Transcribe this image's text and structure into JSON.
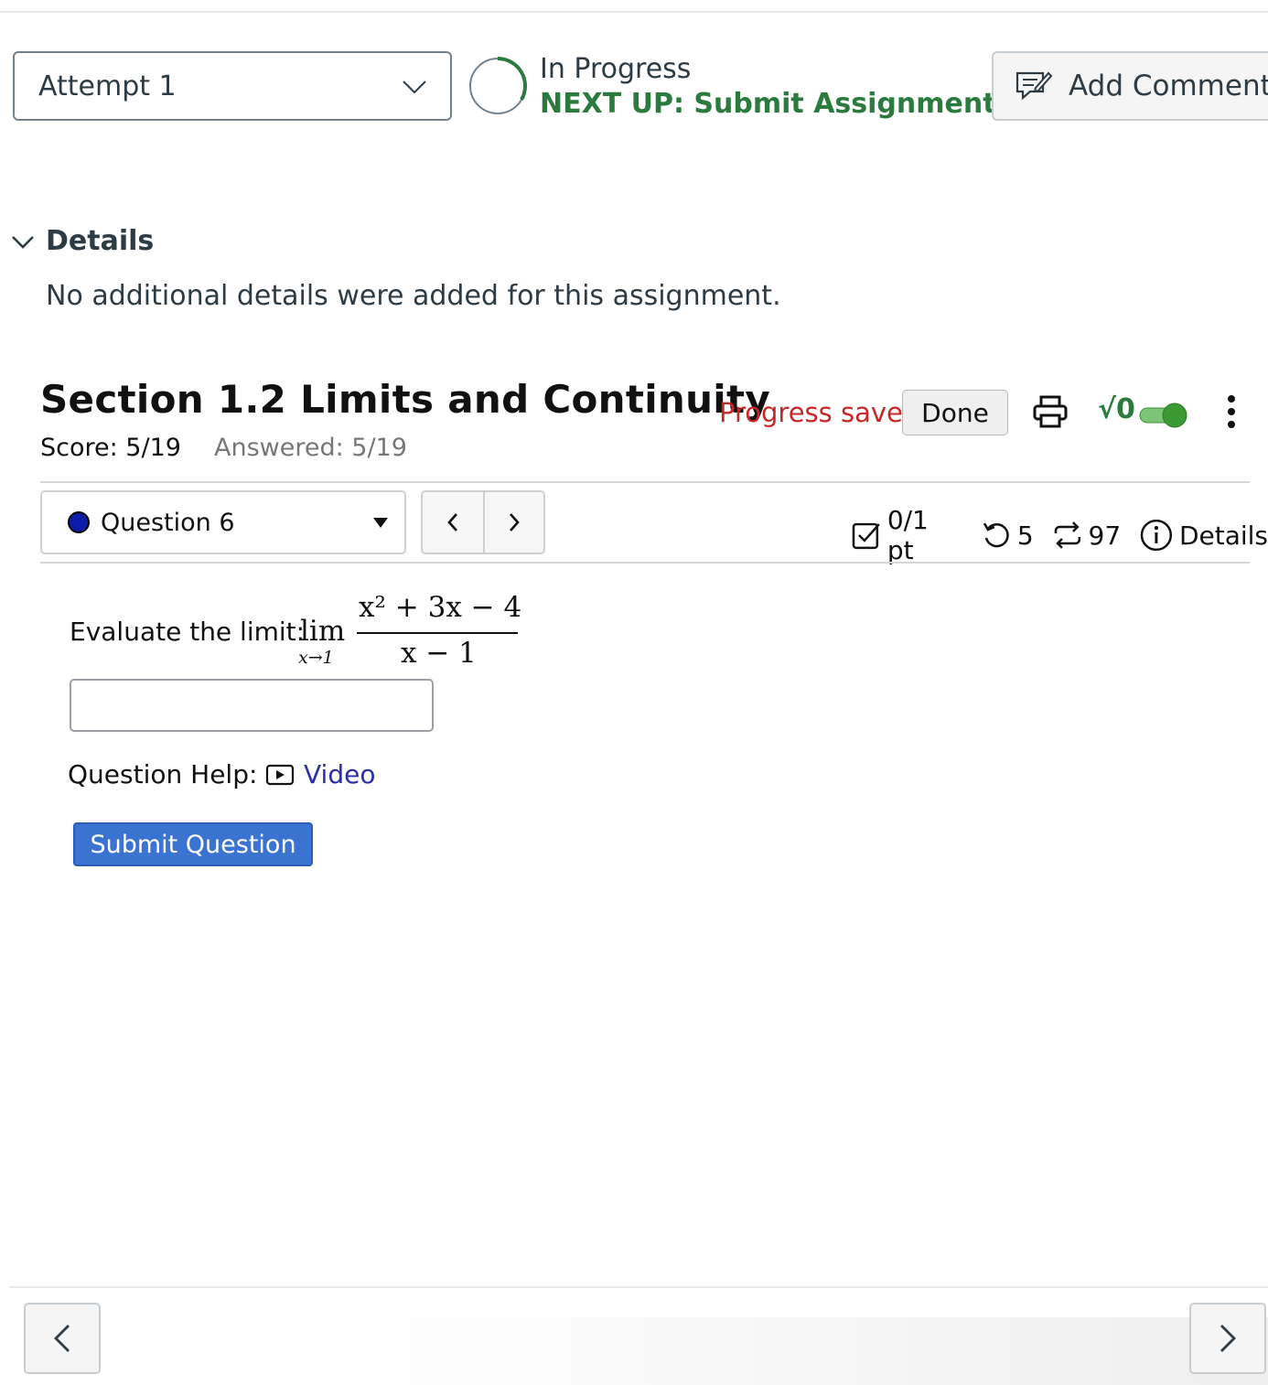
{
  "attempt": {
    "selected": "Attempt 1"
  },
  "status": {
    "label": "In Progress",
    "next_up": "NEXT UP: Submit Assignment",
    "accent": "#2b7a3e"
  },
  "header": {
    "add_comment": "Add Comment"
  },
  "details": {
    "toggle_label": "Details",
    "text": "No additional details were added for this assignment."
  },
  "assignment": {
    "title": "Section 1.2 Limits and Continuity",
    "score": "Score: 5/19",
    "answered": "Answered: 5/19",
    "progress_saved": "Progress saved",
    "done_label": "Done",
    "sqrt_label": "√0",
    "progress_color": "#c62828"
  },
  "question": {
    "selected": "Question 6",
    "points": "0/1 pt",
    "retries": "5",
    "attempts": "97",
    "details_label": "Details",
    "prompt": "Evaluate the limit:",
    "math": {
      "operator": "lim",
      "limit_sub": "x→1",
      "numerator": "x² + 3x − 4",
      "denominator": "x − 1"
    },
    "answer_value": "",
    "help_label": "Question Help:",
    "video_label": "Video",
    "submit_label": "Submit Question",
    "submit_color": "#3b73d1"
  },
  "icons": [
    "chevron-down-icon",
    "progress-ring-icon",
    "comment-icon",
    "print-icon",
    "kebab-menu-icon",
    "chevron-left-icon",
    "chevron-right-icon",
    "checkbox-icon",
    "retry-icon",
    "attempts-icon",
    "info-icon",
    "video-icon"
  ]
}
